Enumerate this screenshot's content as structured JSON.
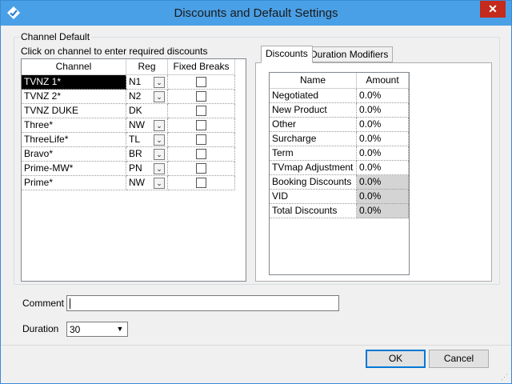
{
  "window": {
    "title": "Discounts and Default Settings",
    "close_glyph": "✕"
  },
  "group": {
    "legend": "Channel Default",
    "hint": "Click on channel to enter required discounts"
  },
  "channel_grid": {
    "headers": [
      "Channel",
      "Reg",
      "Fixed Breaks"
    ],
    "rows": [
      {
        "channel": "TVNZ 1*",
        "reg": "N1",
        "has_combo": true,
        "fixed": false,
        "selected": true
      },
      {
        "channel": "TVNZ 2*",
        "reg": "N2",
        "has_combo": true,
        "fixed": false
      },
      {
        "channel": "TVNZ DUKE",
        "reg": "DK",
        "has_combo": false,
        "fixed": false
      },
      {
        "channel": "Three*",
        "reg": "NW",
        "has_combo": true,
        "fixed": false
      },
      {
        "channel": "ThreeLife*",
        "reg": "TL",
        "has_combo": true,
        "fixed": false
      },
      {
        "channel": "Bravo*",
        "reg": "BR",
        "has_combo": true,
        "fixed": false
      },
      {
        "channel": "Prime-MW*",
        "reg": "PN",
        "has_combo": true,
        "fixed": false
      },
      {
        "channel": "Prime*",
        "reg": "NW",
        "has_combo": true,
        "fixed": false
      }
    ]
  },
  "tabs": [
    {
      "label": "Discounts",
      "active": true
    },
    {
      "label": "Duration Modifiers",
      "active": false
    }
  ],
  "discount_grid": {
    "headers": [
      "Name",
      "Amount"
    ],
    "rows": [
      {
        "name": "Negotiated",
        "amount": "0.0%",
        "readonly": false
      },
      {
        "name": "New Product",
        "amount": "0.0%",
        "readonly": false
      },
      {
        "name": "Other",
        "amount": "0.0%",
        "readonly": false
      },
      {
        "name": "Surcharge",
        "amount": "0.0%",
        "readonly": false
      },
      {
        "name": "Term",
        "amount": "0.0%",
        "readonly": false
      },
      {
        "name": "TVmap Adjustment",
        "amount": "0.0%",
        "readonly": false
      },
      {
        "name": "Booking Discounts",
        "amount": "0.0%",
        "readonly": true
      },
      {
        "name": "VID",
        "amount": "0.0%",
        "readonly": true
      },
      {
        "name": "Total Discounts",
        "amount": "0.0%",
        "readonly": true
      }
    ]
  },
  "comment": {
    "label": "Comment",
    "value": ""
  },
  "duration": {
    "label": "Duration",
    "value": "30"
  },
  "buttons": {
    "ok": "OK",
    "cancel": "Cancel"
  },
  "colors": {
    "titlebar": "#4aa0e6",
    "close": "#c42b1c",
    "selection": "#000000",
    "readonly_cell": "#d4d4d4"
  }
}
